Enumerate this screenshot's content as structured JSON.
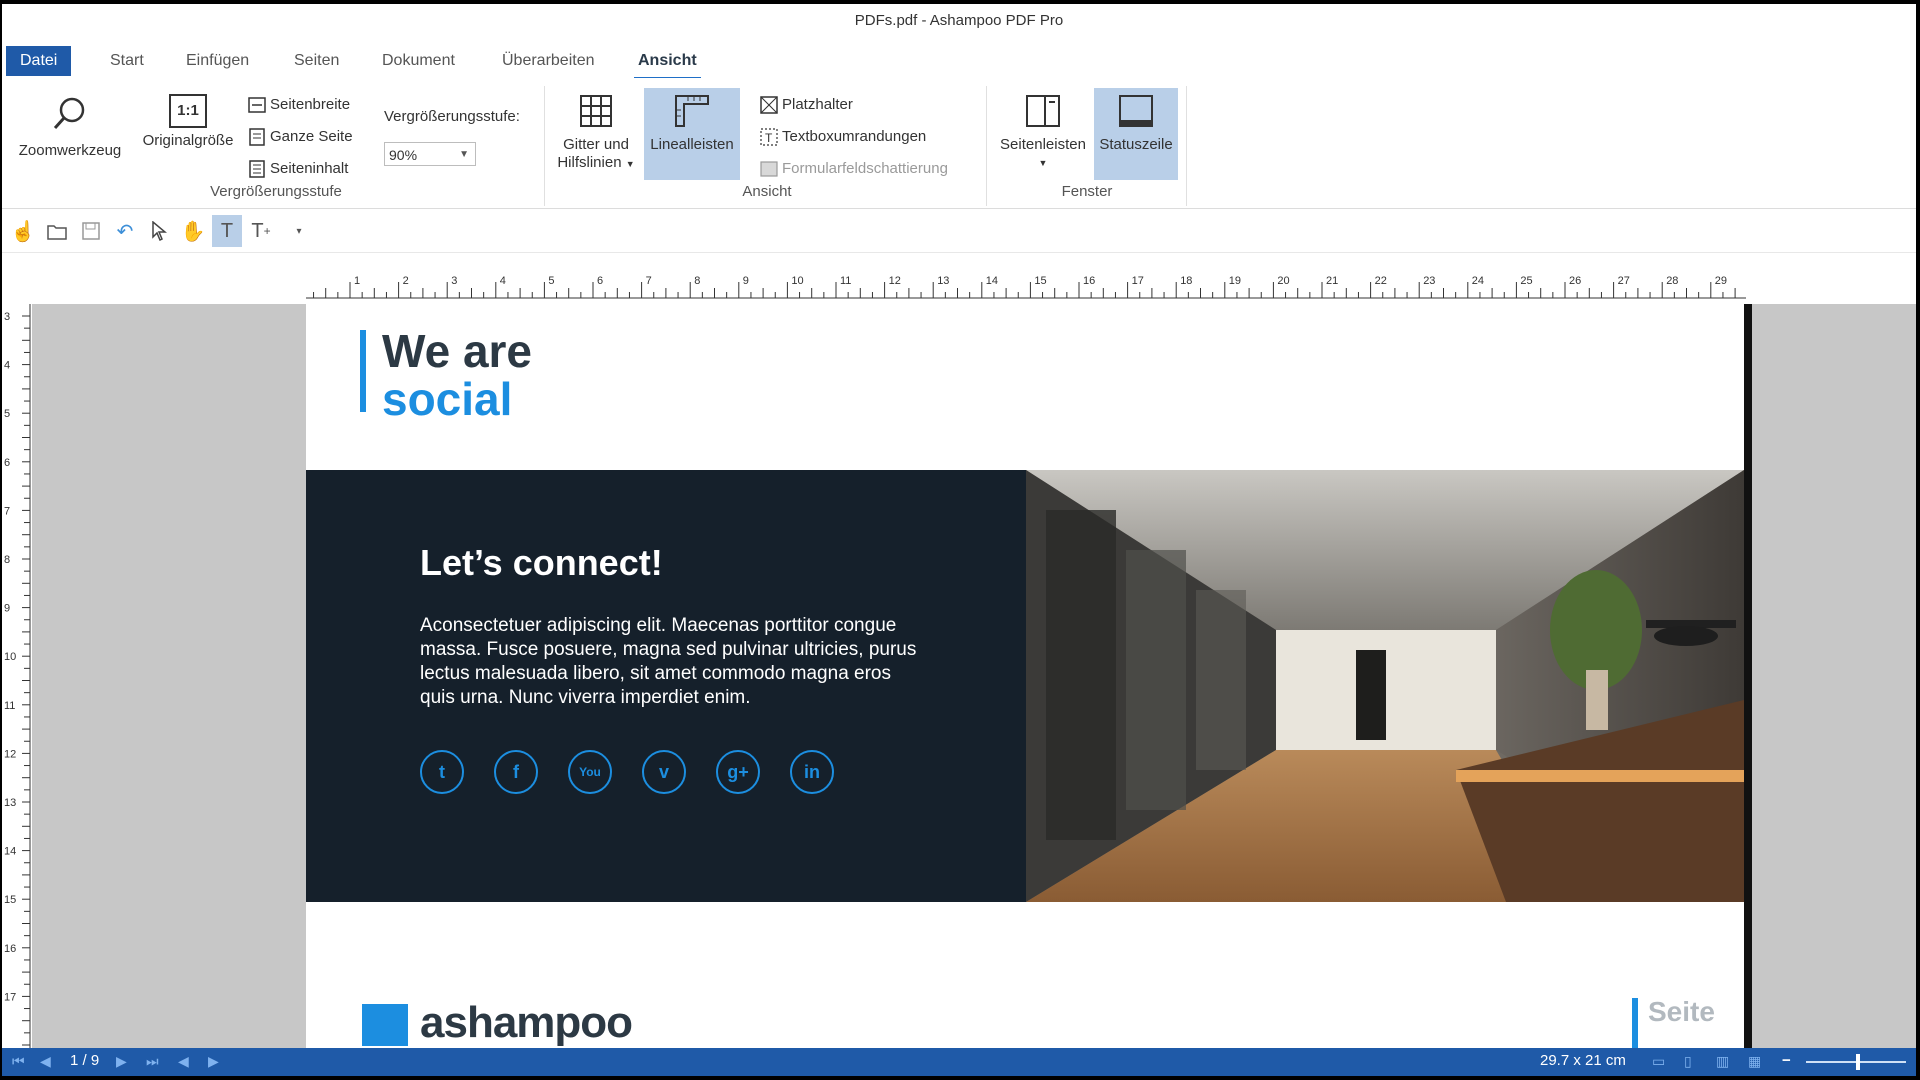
{
  "window": {
    "title": "PDFs.pdf - Ashampoo PDF Pro"
  },
  "menu": {
    "tabs": [
      {
        "label": "Datei"
      },
      {
        "label": "Start"
      },
      {
        "label": "Einfügen"
      },
      {
        "label": "Seiten"
      },
      {
        "label": "Dokument"
      },
      {
        "label": "Überarbeiten"
      },
      {
        "label": "Ansicht"
      }
    ],
    "active": "Ansicht"
  },
  "ribbon": {
    "zoom_group": {
      "label": "Vergrößerungsstufe",
      "zoom_tool": "Zoomwerkzeug",
      "original_size": "Originalgröße",
      "original_icon_text": "1:1",
      "page_width": "Seitenbreite",
      "whole_page": "Ganze Seite",
      "page_content": "Seiteninhalt",
      "zoom_level_label": "Vergrößerungsstufe:",
      "zoom_level_value": "90%"
    },
    "view_group": {
      "label": "Ansicht",
      "grid_line1": "Gitter und",
      "grid_line2": "Hilfslinien",
      "rulers": "Linealleisten",
      "placeholder": "Platzhalter",
      "textbox_borders": "Textboxumrandungen",
      "form_shading": "Formularfeldschattierung"
    },
    "window_group": {
      "label": "Fenster",
      "sidebars": "Seitenleisten",
      "statusbar": "Statuszeile"
    }
  },
  "quickbar": {
    "icons": [
      "hand-pointer-icon",
      "open-folder-icon",
      "save-icon",
      "undo-icon",
      "select-arrow-icon",
      "pan-hand-icon",
      "text-tool-icon",
      "add-text-icon",
      "customize-dropdown-icon"
    ]
  },
  "ruler": {
    "horizontal_ticks": [
      "1",
      "2",
      "3",
      "4",
      "5",
      "6",
      "7",
      "8",
      "9",
      "10",
      "11",
      "12",
      "13",
      "14",
      "15",
      "16",
      "17",
      "18",
      "19",
      "20",
      "21",
      "22",
      "23",
      "24",
      "25",
      "26",
      "27",
      "28",
      "29"
    ],
    "vertical_ticks": [
      "3",
      "4",
      "5",
      "6",
      "7",
      "8",
      "9",
      "10",
      "11",
      "12",
      "13",
      "14",
      "15",
      "16",
      "17"
    ]
  },
  "document": {
    "heading_line1": "We are",
    "heading_line2": "social",
    "connect_title": "Let’s connect!",
    "connect_body": "Aconsectetuer adipiscing elit. Maecenas porttitor congue massa. Fusce posuere, magna sed pulvinar ultricies, purus lectus malesuada libero, sit amet commodo magna eros quis urna. Nunc viverra imperdiet enim.",
    "social_icons": [
      {
        "name": "twitter",
        "glyph": "t"
      },
      {
        "name": "facebook",
        "glyph": "f"
      },
      {
        "name": "youtube",
        "glyph": "You"
      },
      {
        "name": "vimeo",
        "glyph": "v"
      },
      {
        "name": "google-plus",
        "glyph": "g+"
      },
      {
        "name": "linkedin",
        "glyph": "in"
      }
    ],
    "footer_label": "Seite",
    "logo_text": "ashampoo"
  },
  "statusbar": {
    "page_indicator": "1 / 9",
    "page_size": "29.7 x 21 cm"
  },
  "colors": {
    "accent": "#1f5aa8",
    "brand_blue": "#1c8ee0",
    "dark_panel": "#15202b"
  }
}
